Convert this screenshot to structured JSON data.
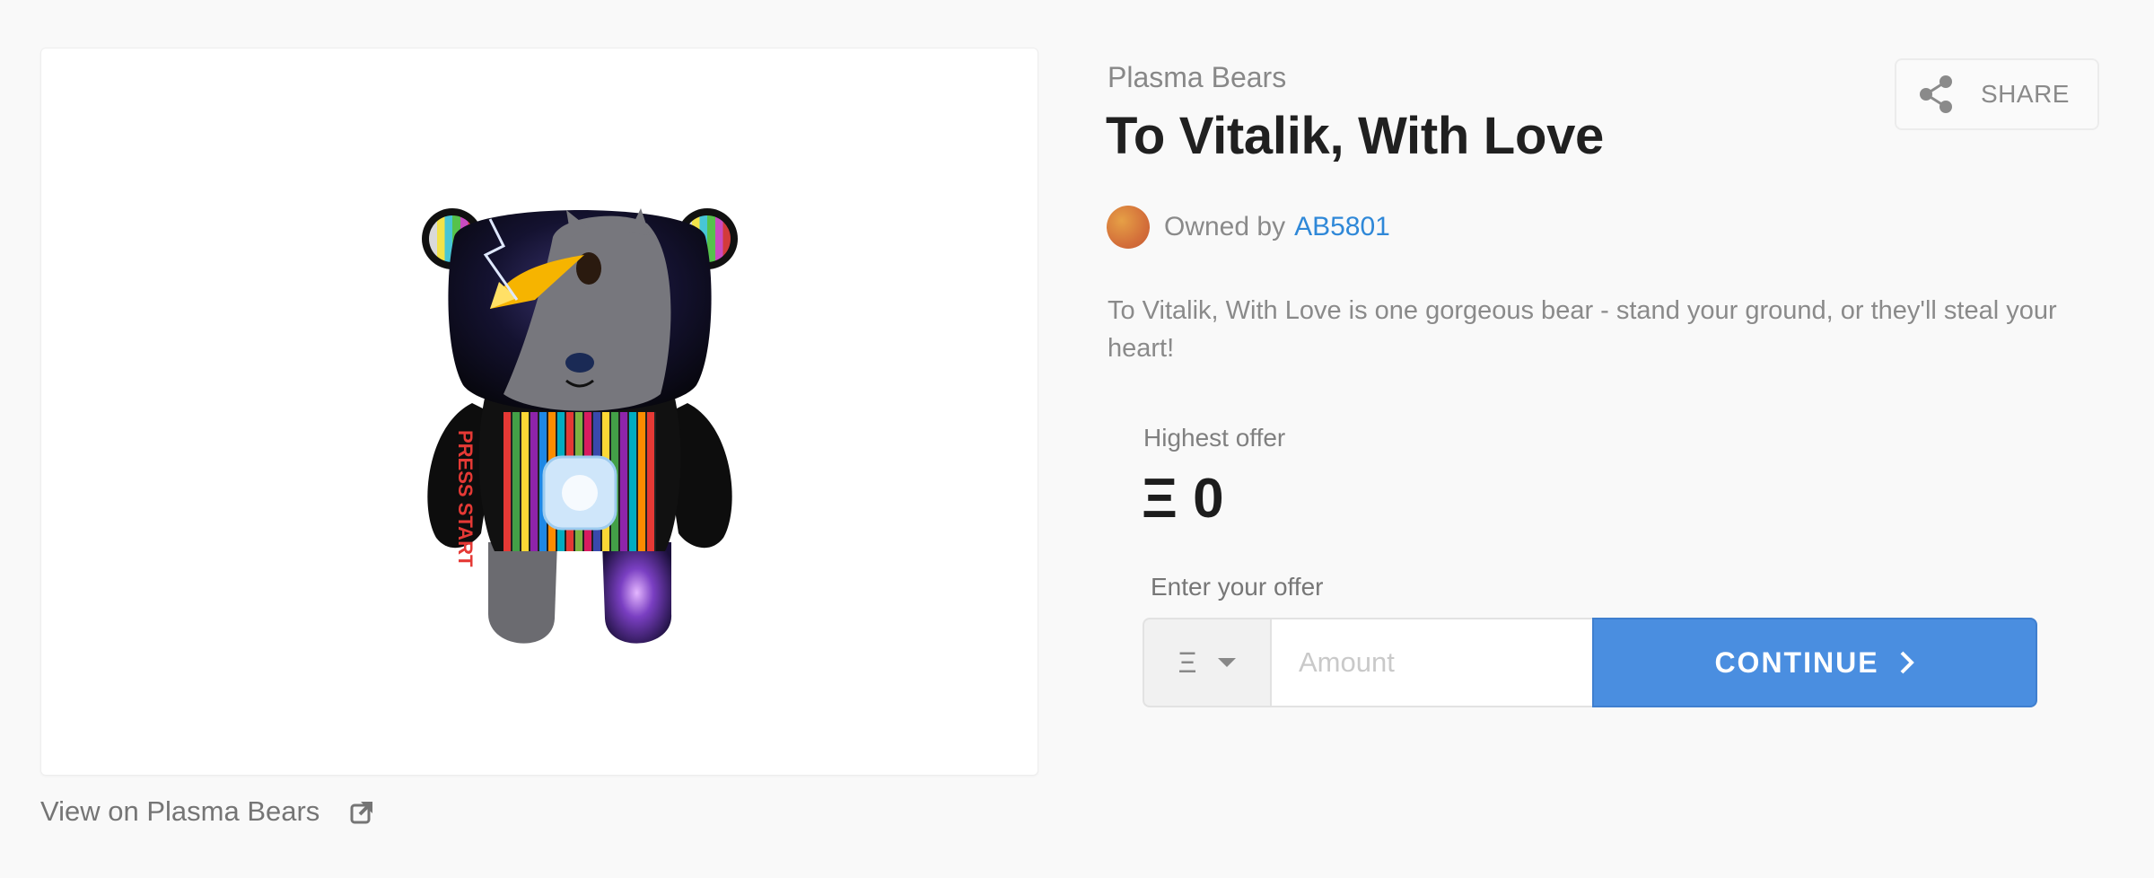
{
  "asset": {
    "collection": "Plasma Bears",
    "title": "To Vitalik, With Love",
    "owner_prefix": "Owned by",
    "owner_name": "AB5801",
    "description": "To Vitalik, With Love is one gorgeous bear - stand your ground, or they'll steal your heart!",
    "view_link": "View on Plasma Bears"
  },
  "share": {
    "label": "SHARE",
    "icon": "share-icon"
  },
  "offer": {
    "highest_label": "Highest offer",
    "highest_value": "Ξ 0",
    "enter_label": "Enter your offer",
    "currency": "Ξ",
    "amount_placeholder": "Amount",
    "continue_label": "CONTINUE"
  },
  "art_text": "PRESS START",
  "colors": {
    "accent": "#4a8ee0",
    "link": "#2f88d8",
    "muted": "#8a8a8a"
  }
}
